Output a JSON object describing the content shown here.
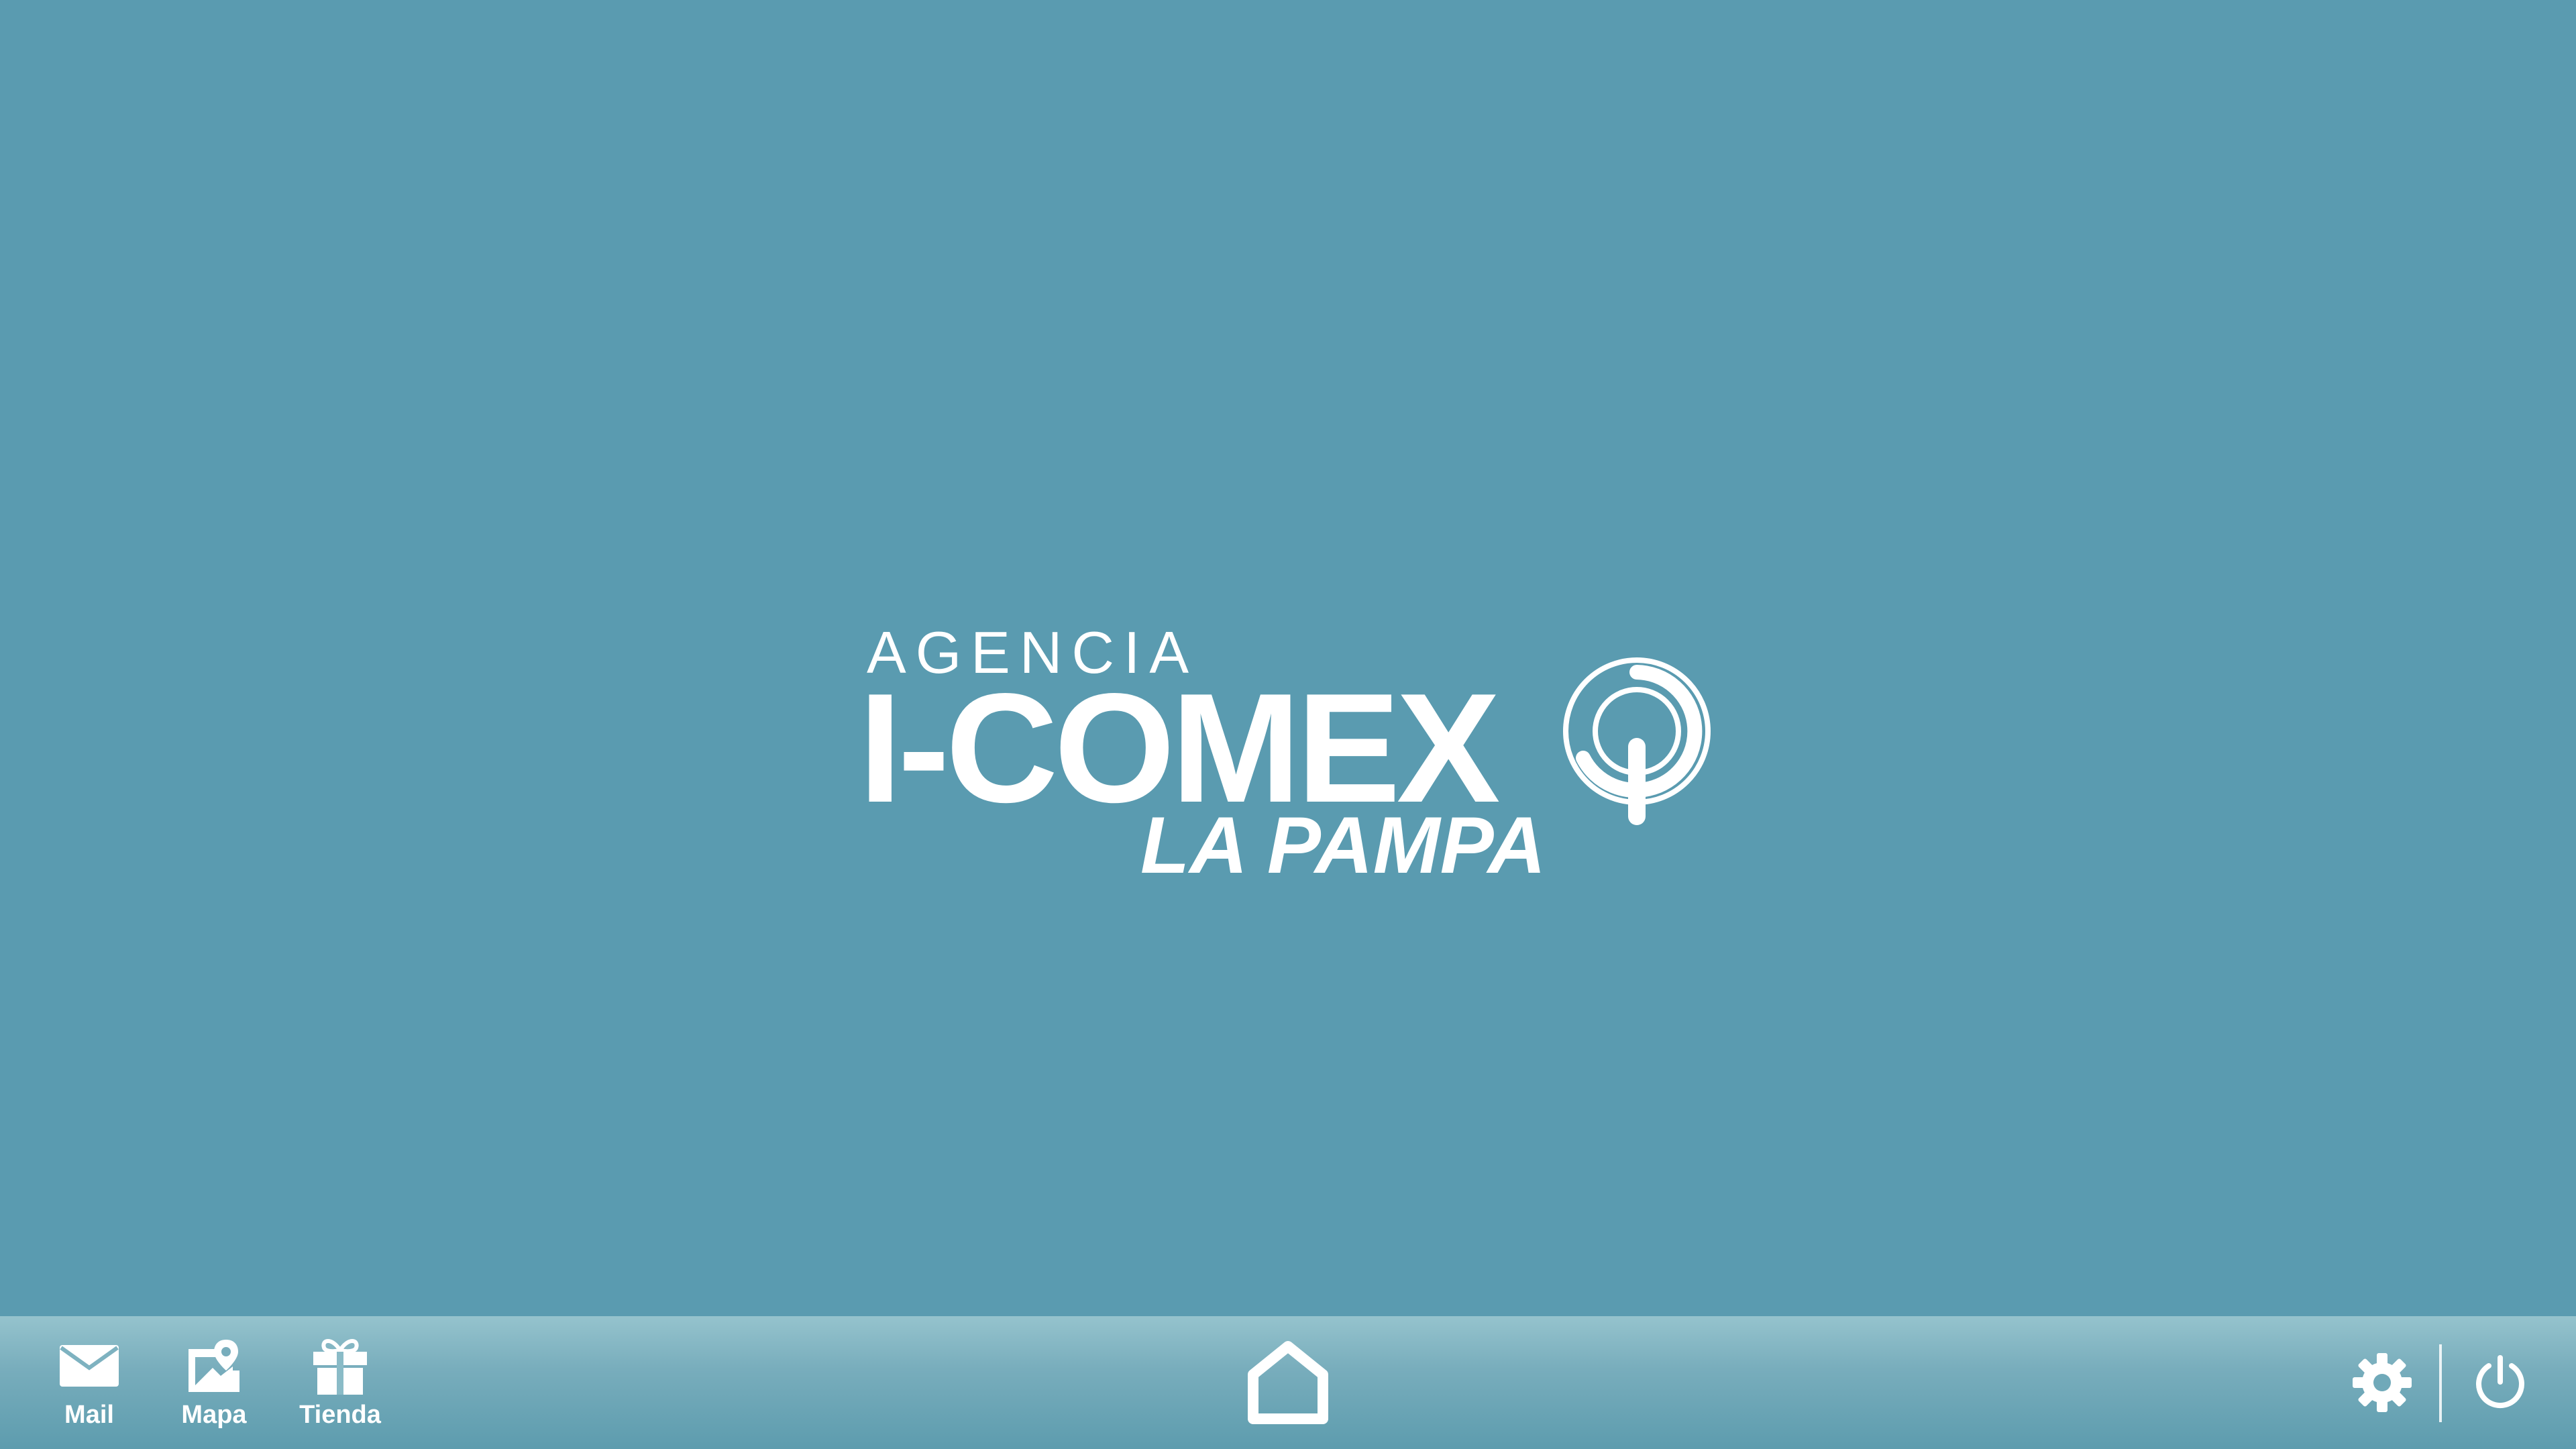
{
  "desktop": {
    "background_color": "#5a9bb0",
    "logo": {
      "line1": "AGENCIA",
      "line2": "I-COMEX",
      "line3": "LA PAMPA"
    }
  },
  "taskbar": {
    "apps": [
      {
        "label": "Mail",
        "icon": "mail-icon"
      },
      {
        "label": "Mapa",
        "icon": "map-icon"
      },
      {
        "label": "Tienda",
        "icon": "gift-icon"
      }
    ],
    "home_icon": "home-icon",
    "settings_icon": "gear-icon",
    "power_icon": "power-icon"
  }
}
